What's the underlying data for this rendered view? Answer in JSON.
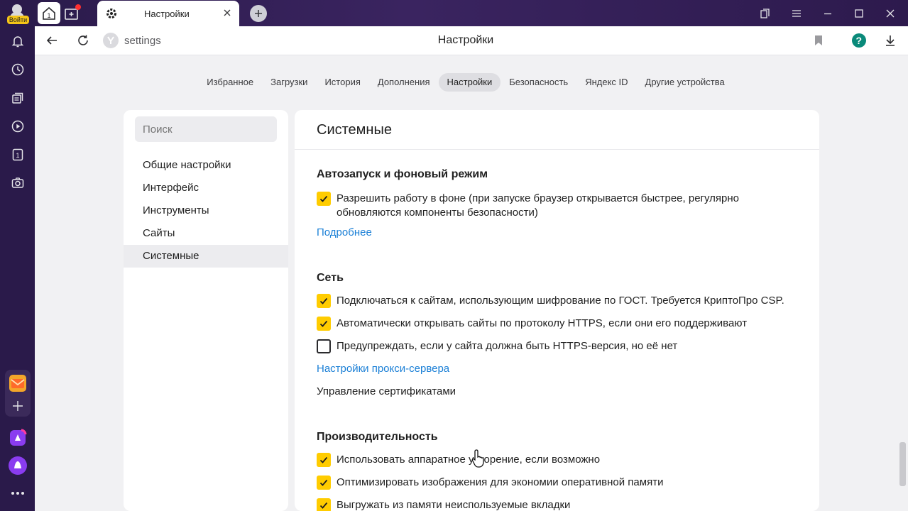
{
  "titlebar": {
    "login_label": "Войти",
    "active_tab_title": "Настройки",
    "icons": [
      "home-icon",
      "new-tab-icon",
      "gear-icon",
      "close-icon",
      "plus-icon",
      "collections-icon",
      "menu-icon",
      "minimize-icon",
      "maximize-icon",
      "close-window-icon"
    ]
  },
  "addressbar": {
    "url": "settings",
    "page_title": "Настройки"
  },
  "sidebar": {
    "icons": [
      "bell-icon",
      "clock-icon",
      "tabs-icon",
      "play-icon",
      "counter-icon",
      "camera-icon",
      "mail-icon",
      "add-icon",
      "alice-icon",
      "alice-circle-icon",
      "more-icon"
    ],
    "counter_value": "1"
  },
  "topnav": {
    "items": [
      {
        "label": "Избранное"
      },
      {
        "label": "Загрузки"
      },
      {
        "label": "История"
      },
      {
        "label": "Дополнения"
      },
      {
        "label": "Настройки",
        "active": true
      },
      {
        "label": "Безопасность"
      },
      {
        "label": "Яндекс ID"
      },
      {
        "label": "Другие устройства"
      }
    ]
  },
  "left_panel": {
    "search_placeholder": "Поиск",
    "menu": [
      {
        "label": "Общие настройки"
      },
      {
        "label": "Интерфейс"
      },
      {
        "label": "Инструменты"
      },
      {
        "label": "Сайты"
      },
      {
        "label": "Системные",
        "active": true
      }
    ]
  },
  "main": {
    "section_title": "Системные",
    "autostart": {
      "title": "Автозапуск и фоновый режим",
      "background_label": "Разрешить работу в фоне (при запуске браузер открывается быстрее, регулярно обновляются компоненты безопасности)",
      "background_checked": true,
      "more_link": "Подробнее"
    },
    "network": {
      "title": "Сеть",
      "gost_label": "Подключаться к сайтам, использующим шифрование по ГОСТ. Требуется КриптоПро CSP.",
      "gost_checked": true,
      "https_label": "Автоматически открывать сайты по протоколу HTTPS, если они его поддерживают",
      "https_checked": true,
      "warn_label": "Предупреждать, если у сайта должна быть HTTPS-версия, но её нет",
      "warn_checked": false,
      "proxy_link": "Настройки прокси-сервера",
      "certs_label": "Управление сертификатами"
    },
    "performance": {
      "title": "Производительность",
      "hw_label": "Использовать аппаратное ускорение, если возможно",
      "hw_checked": true,
      "images_label": "Оптимизировать изображения для экономии оперативной памяти",
      "images_checked": true,
      "unload_label": "Выгружать из памяти неиспользуемые вкладки",
      "unload_checked": true
    }
  },
  "colors": {
    "accent_checkbox": "#ffcc00",
    "link": "#1a7fd6",
    "titlebar": "#2a1a4a"
  }
}
